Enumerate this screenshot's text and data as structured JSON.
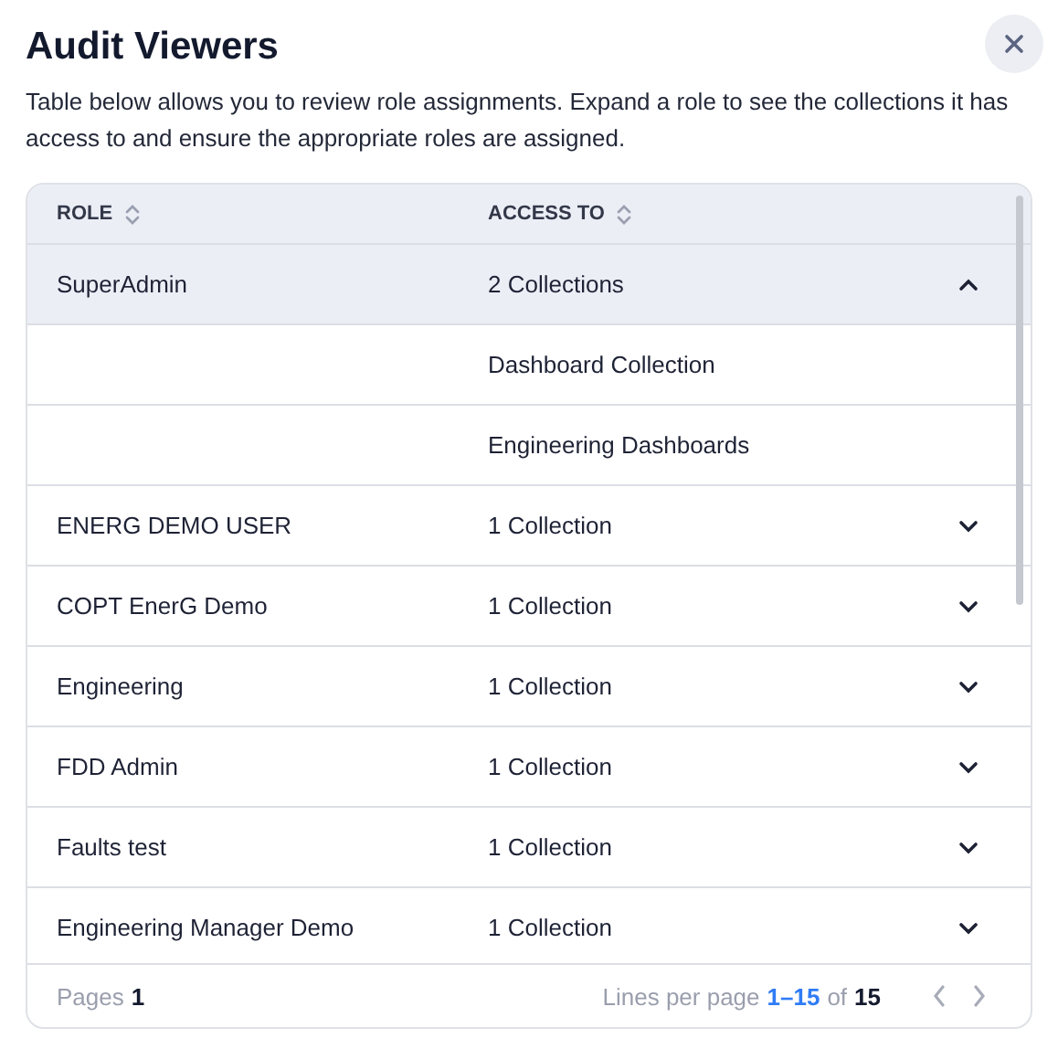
{
  "dialog": {
    "title": "Audit Viewers",
    "description": "Table below allows you to review role assignments. Expand a role to see the collections it has access to and ensure the appropriate roles are assigned."
  },
  "table": {
    "columns": [
      "ROLE",
      "ACCESS TO"
    ],
    "rows": [
      {
        "role": "SuperAdmin",
        "access": "2 Collections",
        "expanded": true,
        "children": [
          {
            "access": "Dashboard Collection"
          },
          {
            "access": "Engineering Dashboards"
          }
        ]
      },
      {
        "role": "ENERG DEMO USER",
        "access": "1 Collection",
        "expanded": false
      },
      {
        "role": "COPT EnerG Demo",
        "access": "1 Collection",
        "expanded": false
      },
      {
        "role": "Engineering",
        "access": "1 Collection",
        "expanded": false
      },
      {
        "role": "FDD Admin",
        "access": "1 Collection",
        "expanded": false
      },
      {
        "role": "Faults test",
        "access": "1 Collection",
        "expanded": false
      },
      {
        "role": "Engineering Manager Demo",
        "access": "1 Collection",
        "expanded": false
      }
    ]
  },
  "pager": {
    "pages_label": "Pages",
    "pages": "1",
    "lines_label": "Lines per page",
    "range": "1–15",
    "of": "of",
    "total": "15"
  }
}
